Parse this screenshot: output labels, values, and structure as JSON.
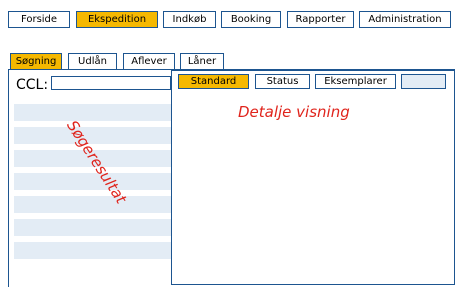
{
  "main_nav": [
    {
      "label": "Forside",
      "active": false
    },
    {
      "label": "Ekspedition",
      "active": true
    },
    {
      "label": "Indkøb",
      "active": false
    },
    {
      "label": "Booking",
      "active": false
    },
    {
      "label": "Rapporter",
      "active": false
    },
    {
      "label": "Administration",
      "active": false
    }
  ],
  "sub_nav": [
    {
      "label": "Søgning",
      "active": true
    },
    {
      "label": "Udlån",
      "active": false
    },
    {
      "label": "Aflever",
      "active": false
    },
    {
      "label": "Låner",
      "active": false
    }
  ],
  "search": {
    "label": "CCL:",
    "value": ""
  },
  "results": {
    "annotation": "Søgeresultat"
  },
  "detail": {
    "tabs": [
      {
        "label": "Standard",
        "active": true
      },
      {
        "label": "Status",
        "active": false
      },
      {
        "label": "Eksemplarer",
        "active": false
      },
      {
        "label": "",
        "active": false
      }
    ],
    "annotation": "Detalje visning"
  },
  "colors": {
    "accent": "#f5b800",
    "border": "#1d5590",
    "row": "#e3ecf5",
    "annotation": "#e0241c"
  }
}
